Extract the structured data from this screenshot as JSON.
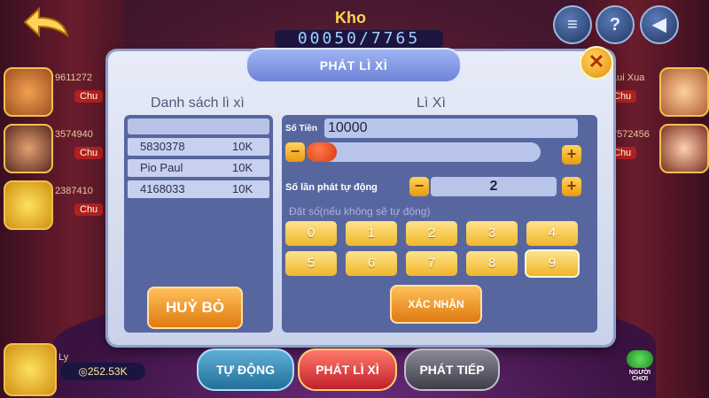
{
  "top": {
    "kho_label": "Kho",
    "kho_digits": "00050/7765"
  },
  "players": [
    {
      "id": "9611272",
      "tag": "Chu"
    },
    {
      "id": "3574940",
      "tag": "Chu"
    },
    {
      "id": "2387410",
      "tag": "Chu"
    },
    {
      "id": "Lui Xua",
      "tag": "Chu"
    },
    {
      "id": "7572456",
      "tag": "Chu"
    }
  ],
  "self": {
    "name": "Ly",
    "balance": "252.53K"
  },
  "modal": {
    "title": "PHÁT LÌ XÌ",
    "close": "✕",
    "list_title": "Danh sách lì xì",
    "list_rows": [
      {
        "id": "5830378",
        "amount": "10K"
      },
      {
        "id": "Pio Paul",
        "amount": "10K"
      },
      {
        "id": "4168033",
        "amount": "10K"
      }
    ],
    "right_title": "Lì Xì",
    "amount_label": "Số Tiền",
    "amount_value": "10000",
    "auto_label": "Số lần phát tự động",
    "auto_count": "2",
    "hint": "Đặt số(nếu không sẽ tự động)",
    "digits": [
      "0",
      "1",
      "2",
      "3",
      "4",
      "5",
      "6",
      "7",
      "8",
      "9"
    ],
    "selected_digit": "9",
    "confirm": "XÁC NHẬN",
    "cancel": "HUỶ BỎ",
    "minus": "−",
    "plus": "+"
  },
  "bottom": {
    "auto": "TỰ ĐỘNG",
    "give": "PHÁT LÌ XÌ",
    "next": "PHÁT TIẾP",
    "players": "NGƯỜI CHƠI"
  },
  "slider_fraction": 0.0
}
